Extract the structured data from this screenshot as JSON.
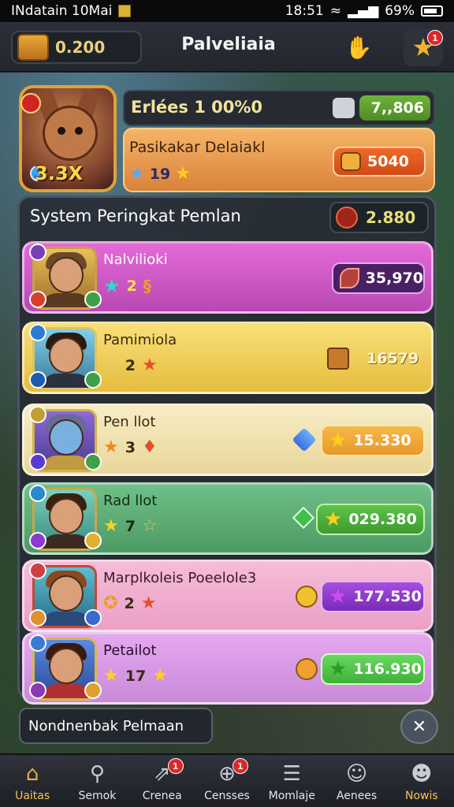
{
  "status_bar": {
    "carrier": "INdatain 10Mai",
    "time": "18:51",
    "battery": "69%"
  },
  "top_bar": {
    "currency_value": "0.200",
    "title": "Palveliaia",
    "badge_count": "1"
  },
  "hero": {
    "header_label": "Erlées 1 00%0",
    "header_value": "7,,806",
    "multiplier": "3.3X",
    "name": "Pasikakar Delaiakl",
    "stars_count": "19",
    "reward_value": "5040"
  },
  "ranking": {
    "title": "System Peringkat Pemlan",
    "total_value": "2.880",
    "rows": [
      {
        "name": "Nalvilioki",
        "stars": "2",
        "score": "35,970"
      },
      {
        "name": "Pamimiola",
        "stars": "2",
        "score": "16579"
      },
      {
        "name": "Pen llot",
        "stars": "3",
        "score": "15.330"
      },
      {
        "name": "Rad llot",
        "stars": "7",
        "score": "029.380"
      },
      {
        "name": "Marplkoleis Poeelole3",
        "stars": "2",
        "score": "177.530"
      },
      {
        "name": "Petailot",
        "stars": "17",
        "score": "116.930"
      }
    ]
  },
  "footer": {
    "field_label": "Nondnenbak Pelmaan"
  },
  "nav": {
    "items": [
      {
        "label": "Uaitas",
        "icon": "home-icon"
      },
      {
        "label": "Semok",
        "icon": "user-icon",
        "badge": ""
      },
      {
        "label": "Crenea",
        "icon": "share-icon",
        "badge": "1"
      },
      {
        "label": "Censses",
        "icon": "globe-icon",
        "badge": "1"
      },
      {
        "label": "Momlaje",
        "icon": "list-icon"
      },
      {
        "label": "Aenees",
        "icon": "face-icon"
      },
      {
        "label": "Nowis",
        "icon": "profile-icon"
      }
    ]
  },
  "colors": {
    "accent_gold": "#f2b23a",
    "row_pink": "#e36ad9",
    "row_yellow": "#f8df78",
    "row_cream": "#f7ecc5",
    "row_green": "#6fbf88",
    "row_rose": "#f6bcd8",
    "row_violet": "#e5a8ef"
  }
}
